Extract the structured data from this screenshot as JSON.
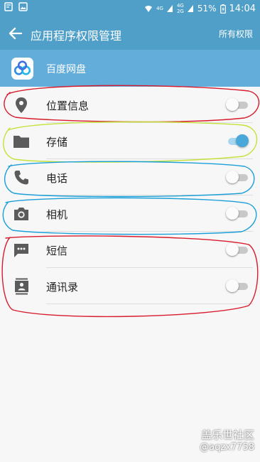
{
  "status_bar": {
    "net_top": "4G",
    "net_mid": "4G",
    "net_bot": "2G",
    "battery": "51%",
    "time": "14:04"
  },
  "header": {
    "title": "应用程序权限管理",
    "action": "所有权限"
  },
  "app": {
    "name": "百度网盘"
  },
  "permissions": [
    {
      "label": "位置信息",
      "icon": "location-pin-icon",
      "enabled": false
    },
    {
      "label": "存储",
      "icon": "folder-icon",
      "enabled": true
    },
    {
      "label": "电话",
      "icon": "phone-icon",
      "enabled": false
    },
    {
      "label": "相机",
      "icon": "camera-icon",
      "enabled": false
    },
    {
      "label": "短信",
      "icon": "message-icon",
      "enabled": false
    },
    {
      "label": "通讯录",
      "icon": "contacts-icon",
      "enabled": false
    }
  ],
  "annotation_colors": [
    "#d81b2c",
    "#c4e23a",
    "#1b9fd8",
    "#1b9fd8",
    "#d81b2c"
  ],
  "watermark": {
    "line1": "盖乐世社区",
    "line2": "@aqzx7758"
  },
  "colors": {
    "appbar": "#4f9fc8",
    "app_row": "#63addb",
    "toggle_on": "#4aa7d9",
    "icon": "#5b5b5b"
  }
}
